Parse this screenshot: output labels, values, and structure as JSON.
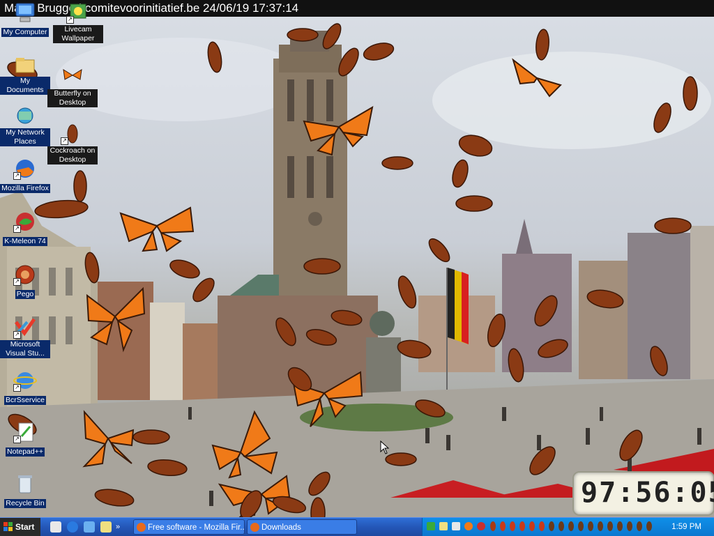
{
  "banner": {
    "text": "Markt Brugge | comitevoorinitiatief.be 24/06/19 17:37:14"
  },
  "desktop_icons": [
    {
      "label": "My Computer"
    },
    {
      "label": "Livecam Wallpaper"
    },
    {
      "label": "My Documents"
    },
    {
      "label": "Butterfly on Desktop"
    },
    {
      "label": "My Network Places"
    },
    {
      "label": "Cockroach on Desktop"
    },
    {
      "label": "Mozilla Firefox"
    },
    {
      "label": "K-Meleon 74"
    },
    {
      "label": "Pego"
    },
    {
      "label": "Microsoft Visual Stu..."
    },
    {
      "label": "BcrSservice"
    },
    {
      "label": "Notepad++"
    },
    {
      "label": "Recycle Bin"
    }
  ],
  "clock": {
    "digits": "97:56:05"
  },
  "taskbar": {
    "start_label": "Start",
    "tasks": [
      {
        "label": "Free software - Mozilla Fir..."
      },
      {
        "label": "Downloads"
      }
    ],
    "time": "1:59 PM"
  },
  "colors": {
    "taskbar_blue": "#2457b8",
    "tray_blue": "#0b77cf",
    "butterfly_orange": "#f07a18",
    "cockroach_brown": "#8a3a14"
  }
}
